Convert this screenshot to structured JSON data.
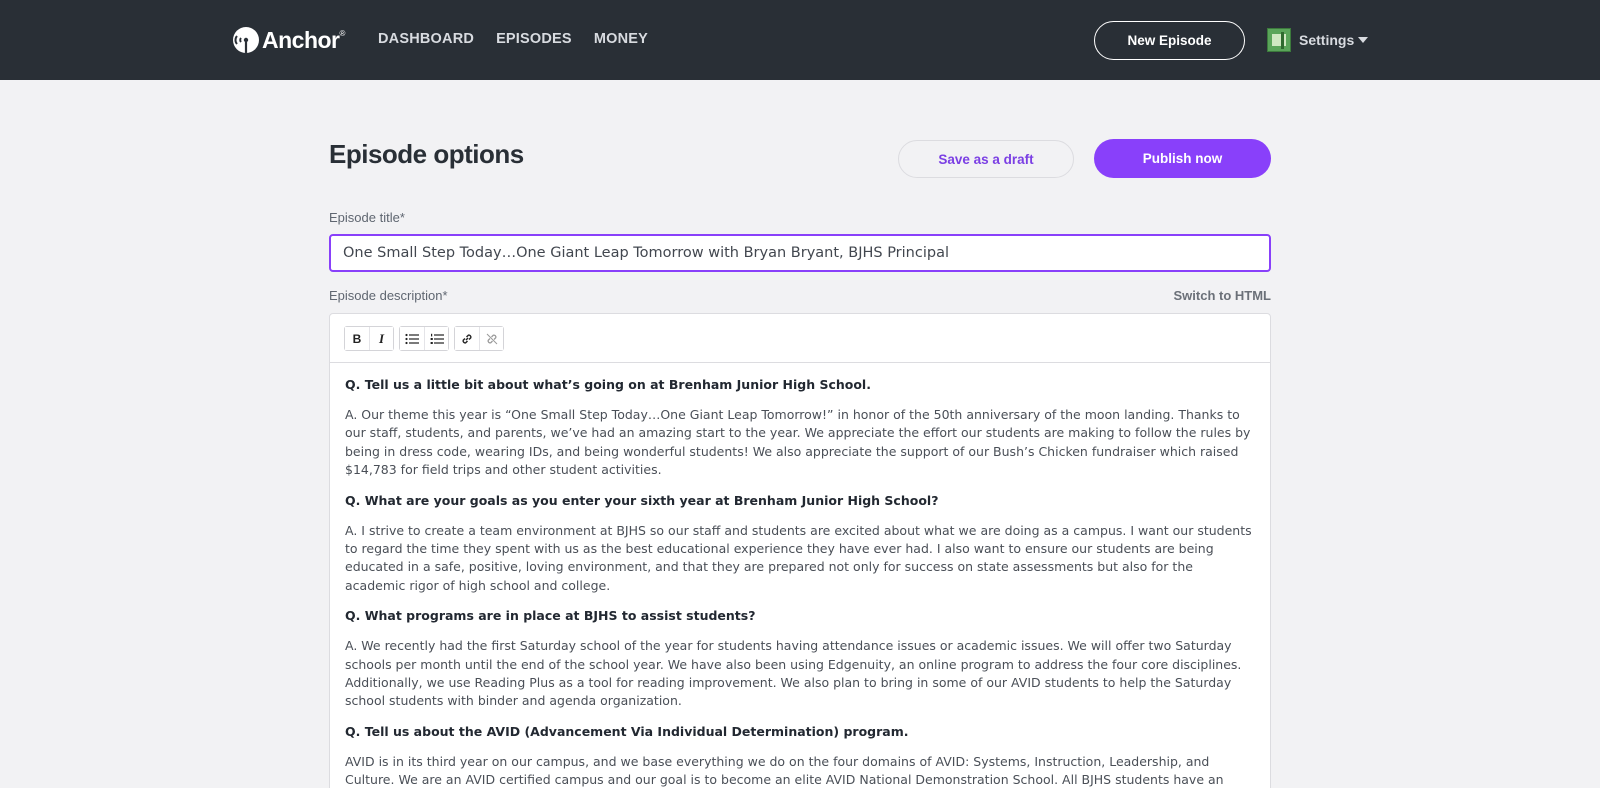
{
  "nav": {
    "logo_text": "Anchor",
    "logo_reg": "®",
    "links": [
      "DASHBOARD",
      "EPISODES",
      "MONEY"
    ],
    "new_episode_label": "New Episode",
    "settings_label": "Settings"
  },
  "page": {
    "title": "Episode options",
    "save_draft_label": "Save as a draft",
    "publish_label": "Publish now"
  },
  "form": {
    "title_label": "Episode title*",
    "title_value": "One Small Step Today…One Giant Leap Tomorrow with Bryan Bryant, BJHS Principal",
    "description_label": "Episode description*",
    "switch_html_label": "Switch to HTML"
  },
  "toolbar": {
    "bold": "B",
    "italic": "I"
  },
  "description": [
    {
      "q": "Q. Tell us a little bit about what’s going on at Brenham Junior High School.",
      "a": "A. Our theme this year is “One Small Step Today…One Giant Leap Tomorrow!” in honor of the 50th anniversary of the moon landing. Thanks to our staff, students, and parents, we’ve had an amazing start to the year. We appreciate the effort our students are making to follow the rules by being in dress code, wearing IDs, and being wonderful students! We also appreciate the support of our Bush’s Chicken fundraiser which raised $14,783 for field trips and other student activities."
    },
    {
      "q": "Q. What are your goals as you enter your sixth year at Brenham Junior High School?",
      "a": "A. I strive to create a team environment at BJHS so our staff and students are excited about what we are doing as a campus. I want our students to regard the time they spent with us as the best educational experience they have ever had. I also want to ensure our students are being educated in a safe, positive, loving environment, and that they are prepared not only for success on state assessments but also for the academic rigor of high school and college."
    },
    {
      "q": "Q. What programs are in place at BJHS to assist students?",
      "a": "A. We recently had the first Saturday school of the year for students having attendance issues or academic issues.  We will offer two Saturday schools per month until the end of the school year. We have also been using Edgenuity, an online program to address the four core disciplines. Additionally, we use Reading Plus as a tool for reading improvement. We also plan to bring in some of our AVID students to help the Saturday school students with binder and agenda organization."
    },
    {
      "q": "Q. Tell us about the AVID (Advancement Via Individual Determination) program.",
      "a": "AVID is in its third year on our campus, and we base everything we do on the four domains of AVID: Systems, Instruction, Leadership, and Culture. We are an AVID certified campus and our goal is to become an elite AVID National Demonstration School. All BJHS students have an organized binder"
    }
  ]
}
